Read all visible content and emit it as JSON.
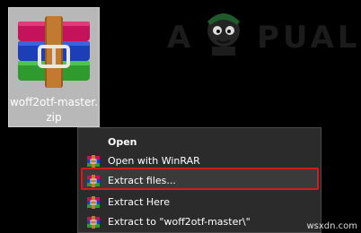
{
  "desktop": {
    "file": {
      "name": "woff2otf-master.zip",
      "name_line1": "woff2otf-master.",
      "name_line2": "zip",
      "icon": "winrar-archive-icon"
    }
  },
  "watermark": {
    "text": "APPUALS",
    "letters_left": "A",
    "letters_right": "PUALS"
  },
  "context_menu": {
    "items": [
      {
        "label": "Open",
        "bold": true,
        "icon": null
      },
      {
        "label": "Open with WinRAR",
        "icon": "winrar-icon"
      },
      {
        "label": "Extract files...",
        "icon": "winrar-icon",
        "highlighted": true
      },
      {
        "label": "Extract Here",
        "icon": "winrar-icon"
      },
      {
        "label": "Extract to \"woff2otf-master\\\"",
        "icon": "winrar-icon"
      }
    ]
  },
  "site_tag": "wsxdn.com",
  "colors": {
    "background": "#000000",
    "menu_background": "#2b2b2b",
    "highlight_border": "#d01c1c",
    "selection": "#b8b8b8"
  }
}
